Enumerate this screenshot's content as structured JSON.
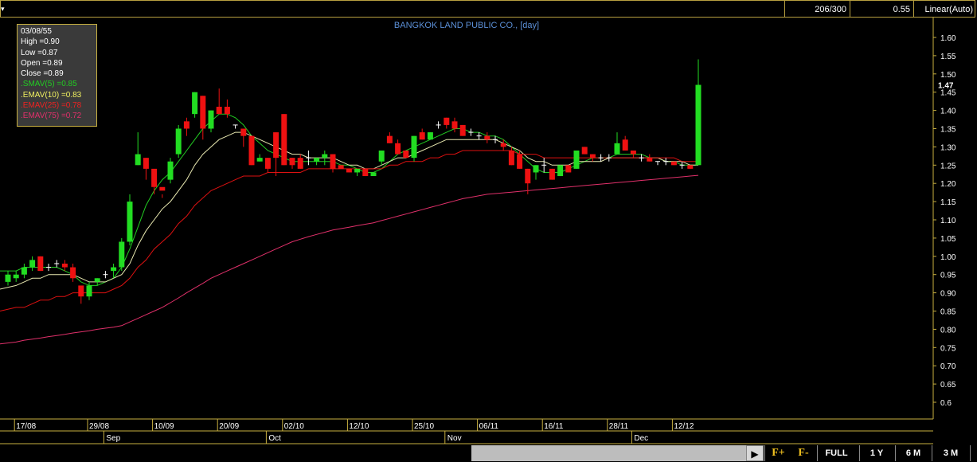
{
  "toolbar": {
    "range_counter": "206/300",
    "scale_value": "0.55",
    "scale_mode": "Linear(Auto)"
  },
  "infobox": {
    "date": "03/08/55",
    "high": "High  =0.90",
    "low": "Low   =0.87",
    "open": "Open  =0.89",
    "close": "Close  =0.89",
    "smav5": ".SMAV(5)    =0.85",
    "emav10": ".EMAV(10)    =0.83",
    "emav25": ".EMAV(25)    =0.78",
    "emav75": ".EMAV(75)    =0.72"
  },
  "buttons": {
    "f_plus": "F+",
    "f_minus": "F-",
    "full": "FULL",
    "y1": "1 Y",
    "m6": "6 M",
    "m3": "3 M"
  },
  "colors": {
    "up": "#22dd22",
    "down": "#ee1111",
    "smav5": "#22cc22",
    "emav10": "#e8e8b0",
    "emav25": "#dd1111",
    "emav75": "#e0306a",
    "axis": "#c8b040"
  },
  "chart_data": {
    "type": "candlestick",
    "title": "BANGKOK LAND PUBLIC CO., [day]",
    "ylim": [
      0.55,
      1.65
    ],
    "yticks": [
      0.6,
      0.65,
      0.7,
      0.75,
      0.8,
      0.85,
      0.9,
      0.95,
      1.0,
      1.05,
      1.1,
      1.15,
      1.2,
      1.25,
      1.3,
      1.35,
      1.4,
      1.45,
      1.5,
      1.55,
      1.6
    ],
    "ytick_labels": [
      "0.6",
      "0.65",
      "0.70",
      "0.75",
      "0.80",
      "0.85",
      "0.90",
      "0.95",
      "1.00",
      "1.05",
      "1.10",
      "1.15",
      "1.20",
      "1.25",
      "1.30",
      "1.35",
      "1.40",
      "1.45",
      "1.50",
      "1.55",
      "1.60"
    ],
    "last_price_label": "1.47",
    "x_date_labels": [
      {
        "label": "17/08",
        "index": 1
      },
      {
        "label": "29/08",
        "index": 10
      },
      {
        "label": "10/09",
        "index": 18
      },
      {
        "label": "20/09",
        "index": 26
      },
      {
        "label": "02/10",
        "index": 34
      },
      {
        "label": "12/10",
        "index": 42
      },
      {
        "label": "25/10",
        "index": 50
      },
      {
        "label": "06/11",
        "index": 58
      },
      {
        "label": "16/11",
        "index": 66
      },
      {
        "label": "28/11",
        "index": 74
      },
      {
        "label": "12/12",
        "index": 82
      }
    ],
    "x_month_labels": [
      {
        "label": "Sep",
        "index": 12
      },
      {
        "label": "Oct",
        "index": 32
      },
      {
        "label": "Nov",
        "index": 54
      },
      {
        "label": "Dec",
        "index": 77
      }
    ],
    "candles": [
      [
        0.93,
        0.96,
        0.92,
        0.95
      ],
      [
        0.94,
        0.96,
        0.93,
        0.95
      ],
      [
        0.95,
        0.98,
        0.94,
        0.97
      ],
      [
        0.97,
        1.0,
        0.96,
        0.99
      ],
      [
        1.0,
        1.0,
        0.96,
        0.96
      ],
      [
        0.97,
        0.98,
        0.96,
        0.97
      ],
      [
        0.98,
        0.99,
        0.97,
        0.98
      ],
      [
        0.98,
        0.99,
        0.96,
        0.97
      ],
      [
        0.97,
        0.98,
        0.93,
        0.94
      ],
      [
        0.92,
        0.92,
        0.87,
        0.89
      ],
      [
        0.89,
        0.93,
        0.88,
        0.92
      ],
      [
        0.93,
        0.94,
        0.92,
        0.94
      ],
      [
        0.95,
        0.96,
        0.94,
        0.95
      ],
      [
        0.96,
        0.98,
        0.94,
        0.97
      ],
      [
        0.97,
        1.05,
        0.96,
        1.04
      ],
      [
        1.04,
        1.17,
        1.03,
        1.15
      ],
      [
        1.25,
        1.34,
        1.25,
        1.28
      ],
      [
        1.27,
        1.27,
        1.21,
        1.24
      ],
      [
        1.24,
        1.22,
        1.17,
        1.19
      ],
      [
        1.19,
        1.17,
        1.16,
        1.18
      ],
      [
        1.21,
        1.27,
        1.2,
        1.26
      ],
      [
        1.28,
        1.36,
        1.27,
        1.35
      ],
      [
        1.37,
        1.38,
        1.33,
        1.35
      ],
      [
        1.39,
        1.45,
        1.38,
        1.45
      ],
      [
        1.44,
        1.44,
        1.32,
        1.35
      ],
      [
        1.35,
        1.4,
        1.34,
        1.4
      ],
      [
        1.41,
        1.46,
        1.39,
        1.39
      ],
      [
        1.41,
        1.43,
        1.38,
        1.39
      ],
      [
        1.36,
        1.36,
        1.35,
        1.36
      ],
      [
        1.35,
        1.35,
        1.3,
        1.33
      ],
      [
        1.33,
        1.33,
        1.25,
        1.25
      ],
      [
        1.26,
        1.28,
        1.26,
        1.27
      ],
      [
        1.27,
        1.27,
        1.23,
        1.24
      ],
      [
        1.34,
        1.34,
        1.22,
        1.27
      ],
      [
        1.39,
        1.39,
        1.25,
        1.25
      ],
      [
        1.27,
        1.27,
        1.24,
        1.25
      ],
      [
        1.27,
        1.28,
        1.24,
        1.24
      ],
      [
        1.27,
        1.29,
        1.25,
        1.27
      ],
      [
        1.26,
        1.27,
        1.25,
        1.27
      ],
      [
        1.27,
        1.29,
        1.25,
        1.28
      ],
      [
        1.28,
        1.28,
        1.23,
        1.24
      ],
      [
        1.25,
        1.25,
        1.24,
        1.24
      ],
      [
        1.24,
        1.24,
        1.23,
        1.23
      ],
      [
        1.23,
        1.24,
        1.22,
        1.24
      ],
      [
        1.24,
        1.24,
        1.22,
        1.22
      ],
      [
        1.22,
        1.23,
        1.22,
        1.23
      ],
      [
        1.26,
        1.29,
        1.25,
        1.29
      ],
      [
        1.33,
        1.34,
        1.31,
        1.31
      ],
      [
        1.31,
        1.32,
        1.28,
        1.28
      ],
      [
        1.29,
        1.29,
        1.27,
        1.27
      ],
      [
        1.27,
        1.33,
        1.26,
        1.33
      ],
      [
        1.34,
        1.35,
        1.32,
        1.32
      ],
      [
        1.32,
        1.34,
        1.32,
        1.34
      ],
      [
        1.36,
        1.37,
        1.35,
        1.36
      ],
      [
        1.38,
        1.38,
        1.35,
        1.36
      ],
      [
        1.37,
        1.38,
        1.34,
        1.35
      ],
      [
        1.36,
        1.36,
        1.33,
        1.33
      ],
      [
        1.34,
        1.35,
        1.33,
        1.34
      ],
      [
        1.33,
        1.34,
        1.32,
        1.33
      ],
      [
        1.33,
        1.34,
        1.31,
        1.32
      ],
      [
        1.32,
        1.33,
        1.31,
        1.32
      ],
      [
        1.31,
        1.32,
        1.29,
        1.3
      ],
      [
        1.29,
        1.3,
        1.25,
        1.25
      ],
      [
        1.28,
        1.29,
        1.24,
        1.24
      ],
      [
        1.24,
        1.24,
        1.17,
        1.2
      ],
      [
        1.23,
        1.25,
        1.21,
        1.25
      ],
      [
        1.25,
        1.27,
        1.23,
        1.25
      ],
      [
        1.24,
        1.24,
        1.21,
        1.21
      ],
      [
        1.22,
        1.25,
        1.22,
        1.25
      ],
      [
        1.25,
        1.25,
        1.23,
        1.23
      ],
      [
        1.24,
        1.29,
        1.24,
        1.29
      ],
      [
        1.3,
        1.3,
        1.28,
        1.28
      ],
      [
        1.28,
        1.28,
        1.26,
        1.27
      ],
      [
        1.27,
        1.28,
        1.26,
        1.27
      ],
      [
        1.27,
        1.28,
        1.26,
        1.27
      ],
      [
        1.28,
        1.34,
        1.28,
        1.31
      ],
      [
        1.32,
        1.33,
        1.29,
        1.29
      ],
      [
        1.29,
        1.28,
        1.27,
        1.28
      ],
      [
        1.27,
        1.28,
        1.26,
        1.27
      ],
      [
        1.27,
        1.28,
        1.26,
        1.26
      ],
      [
        1.26,
        1.26,
        1.25,
        1.26
      ],
      [
        1.26,
        1.27,
        1.25,
        1.26
      ],
      [
        1.26,
        1.26,
        1.25,
        1.25
      ],
      [
        1.25,
        1.26,
        1.24,
        1.25
      ],
      [
        1.25,
        1.25,
        1.24,
        1.24
      ],
      [
        1.25,
        1.54,
        1.25,
        1.47
      ]
    ],
    "series": [
      {
        "name": "SMAV(5)",
        "values": [
          0.96,
          0.96,
          0.97,
          0.97,
          0.97,
          0.97,
          0.97,
          0.96,
          0.95,
          0.93,
          0.92,
          0.92,
          0.93,
          0.94,
          0.97,
          1.02,
          1.08,
          1.14,
          1.18,
          1.21,
          1.23,
          1.26,
          1.29,
          1.32,
          1.35,
          1.37,
          1.39,
          1.39,
          1.38,
          1.36,
          1.33,
          1.31,
          1.29,
          1.28,
          1.27,
          1.26,
          1.26,
          1.26,
          1.26,
          1.26,
          1.26,
          1.25,
          1.25,
          1.24,
          1.23,
          1.23,
          1.24,
          1.26,
          1.28,
          1.29,
          1.3,
          1.31,
          1.32,
          1.33,
          1.34,
          1.35,
          1.35,
          1.34,
          1.34,
          1.33,
          1.33,
          1.32,
          1.3,
          1.28,
          1.26,
          1.24,
          1.23,
          1.23,
          1.23,
          1.24,
          1.25,
          1.26,
          1.27,
          1.27,
          1.27,
          1.28,
          1.28,
          1.28,
          1.28,
          1.27,
          1.27,
          1.26,
          1.26,
          1.25,
          1.25,
          1.25
        ]
      },
      {
        "name": "EMAV(10)",
        "values": [
          0.91,
          0.92,
          0.93,
          0.94,
          0.94,
          0.95,
          0.95,
          0.95,
          0.95,
          0.94,
          0.93,
          0.93,
          0.93,
          0.94,
          0.95,
          0.98,
          1.03,
          1.07,
          1.1,
          1.13,
          1.15,
          1.18,
          1.21,
          1.25,
          1.28,
          1.3,
          1.32,
          1.33,
          1.34,
          1.34,
          1.33,
          1.32,
          1.31,
          1.3,
          1.29,
          1.28,
          1.28,
          1.27,
          1.27,
          1.27,
          1.27,
          1.26,
          1.25,
          1.25,
          1.24,
          1.24,
          1.25,
          1.26,
          1.27,
          1.27,
          1.28,
          1.29,
          1.3,
          1.31,
          1.32,
          1.32,
          1.32,
          1.32,
          1.32,
          1.32,
          1.32,
          1.31,
          1.3,
          1.29,
          1.27,
          1.26,
          1.26,
          1.25,
          1.25,
          1.25,
          1.26,
          1.26,
          1.26,
          1.26,
          1.27,
          1.27,
          1.27,
          1.27,
          1.27,
          1.27,
          1.27,
          1.26,
          1.26,
          1.26,
          1.25,
          1.25
        ]
      },
      {
        "name": "EMAV(25)",
        "values": [
          0.85,
          0.86,
          0.86,
          0.87,
          0.88,
          0.88,
          0.89,
          0.89,
          0.9,
          0.9,
          0.9,
          0.9,
          0.9,
          0.91,
          0.92,
          0.94,
          0.97,
          0.99,
          1.02,
          1.04,
          1.06,
          1.09,
          1.11,
          1.14,
          1.16,
          1.18,
          1.19,
          1.2,
          1.21,
          1.22,
          1.22,
          1.22,
          1.23,
          1.23,
          1.23,
          1.23,
          1.23,
          1.24,
          1.24,
          1.24,
          1.24,
          1.24,
          1.24,
          1.24,
          1.24,
          1.24,
          1.24,
          1.25,
          1.25,
          1.26,
          1.26,
          1.26,
          1.27,
          1.27,
          1.28,
          1.28,
          1.29,
          1.29,
          1.29,
          1.29,
          1.29,
          1.29,
          1.29,
          1.28,
          1.28,
          1.28,
          1.27,
          1.27,
          1.27,
          1.27,
          1.27,
          1.27,
          1.27,
          1.27,
          1.27,
          1.27,
          1.27,
          1.27,
          1.27,
          1.27,
          1.27,
          1.27,
          1.27,
          1.26,
          1.26,
          1.26
        ]
      },
      {
        "name": "EMAV(75)",
        "values": [
          0.76,
          0.765,
          0.77,
          0.773,
          0.776,
          0.78,
          0.783,
          0.786,
          0.79,
          0.793,
          0.796,
          0.8,
          0.803,
          0.806,
          0.81,
          0.82,
          0.83,
          0.84,
          0.85,
          0.86,
          0.873,
          0.886,
          0.9,
          0.913,
          0.926,
          0.94,
          0.95,
          0.96,
          0.97,
          0.98,
          0.99,
          1.0,
          1.01,
          1.02,
          1.03,
          1.04,
          1.047,
          1.054,
          1.06,
          1.066,
          1.072,
          1.076,
          1.08,
          1.084,
          1.088,
          1.092,
          1.098,
          1.104,
          1.11,
          1.116,
          1.122,
          1.128,
          1.134,
          1.14,
          1.146,
          1.152,
          1.158,
          1.162,
          1.166,
          1.17,
          1.172,
          1.174,
          1.176,
          1.178,
          1.18,
          1.182,
          1.184,
          1.186,
          1.188,
          1.19,
          1.192,
          1.194,
          1.196,
          1.198,
          1.2,
          1.202,
          1.204,
          1.206,
          1.208,
          1.21,
          1.212,
          1.214,
          1.216,
          1.218,
          1.22,
          1.222
        ]
      }
    ]
  }
}
